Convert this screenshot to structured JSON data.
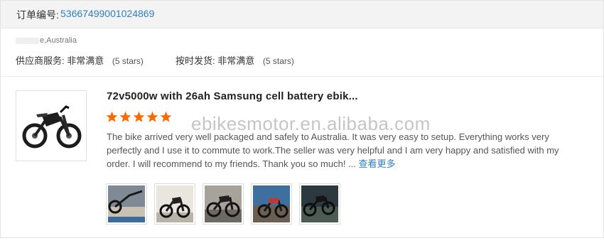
{
  "order": {
    "label": "订单编号:",
    "number": "53667499001024869"
  },
  "buyer": {
    "location": "e,Australia"
  },
  "ratings": [
    {
      "label": "供应商服务:",
      "value": "非常满意",
      "stars_text": "(5 stars)"
    },
    {
      "label": "按时发货:",
      "value": "非常满意",
      "stars_text": "(5 stars)"
    }
  ],
  "product": {
    "title": "72v5000w with 26ah Samsung cell battery ebik...",
    "image_icon": "electric-motorbike-photo",
    "rating_stars": 5
  },
  "review": {
    "text": "The bike arrived very well packaged and safely to Australia. It was very easy to setup. Everything works very perfectly and I use it to commute to work.The seller was very helpful and I am very happy and satisfied with my order. I will recommend to my friends. Thank you so much! ... ",
    "more_label": "查看更多"
  },
  "watermark": "ebikesmotor.en.alibaba.com",
  "colors": {
    "accent": "#2f7fc1",
    "star": "#ff6a00",
    "header_bg": "#f3f3f3"
  },
  "thumbnails": [
    {
      "icon": "bike-photo-thumbnail-1"
    },
    {
      "icon": "bike-photo-thumbnail-2"
    },
    {
      "icon": "bike-photo-thumbnail-3"
    },
    {
      "icon": "bike-photo-thumbnail-4"
    },
    {
      "icon": "bike-photo-thumbnail-5"
    }
  ]
}
